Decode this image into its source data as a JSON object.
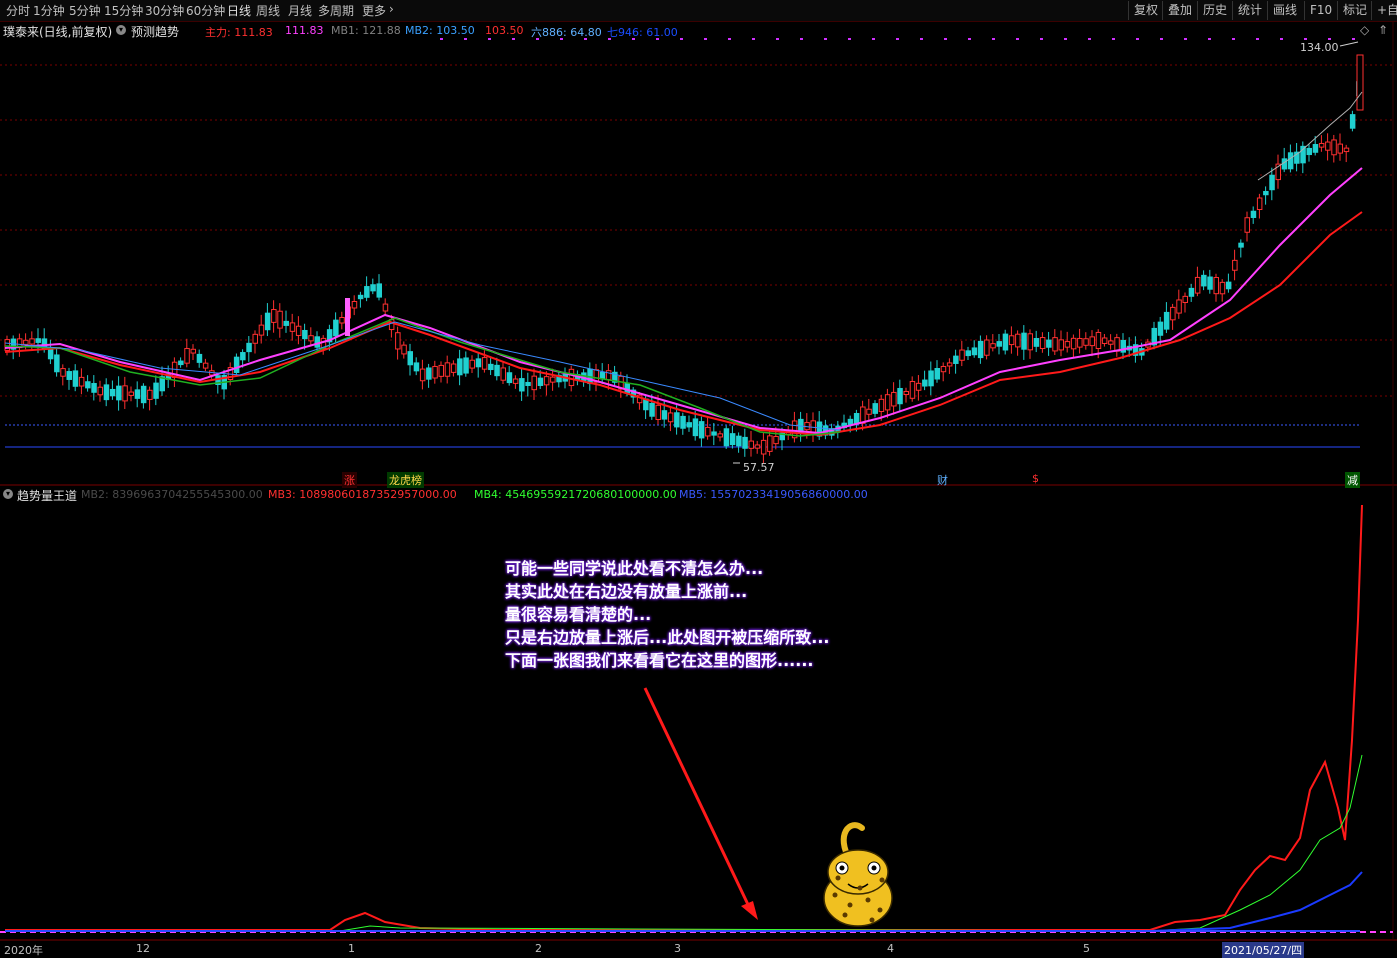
{
  "toolbar": {
    "periods": [
      "分时",
      "1分钟",
      "5分钟",
      "15分钟",
      "30分钟",
      "60分钟",
      "日线",
      "周线",
      "月线",
      "多周期",
      "更多"
    ],
    "active_period": "日线",
    "more_arrow": "›",
    "right_buttons": [
      "复权",
      "叠加",
      "历史",
      "统计",
      "画线",
      "F10",
      "标记",
      "+自选"
    ]
  },
  "header": {
    "stock_title": "璞泰来(日线,前复权)",
    "forecast_label": "预测趋势",
    "indicators": [
      {
        "label": "主力: 111.83",
        "color": "#ff3030"
      },
      {
        "label": "111.83",
        "color": "#ff40ff"
      },
      {
        "label": "MB1: 121.88",
        "color": "#808080"
      },
      {
        "label": "MB2: 103.50",
        "color": "#3aa0ff"
      },
      {
        "label": "103.50",
        "color": "#ff3030"
      },
      {
        "label": "六886: 64.80",
        "color": "#5fb0ff"
      },
      {
        "label": "七946: 61.00",
        "color": "#1a4dff"
      }
    ]
  },
  "price_chart": {
    "high_marker": "134.00",
    "low_marker": "57.57",
    "events": [
      {
        "label": "涨",
        "color": "#ff3030",
        "bg": "#2a0000"
      },
      {
        "label": "龙虎榜",
        "color": "#ffd84a",
        "bg": "#003a00"
      },
      {
        "label": "财",
        "color": "#5fb0ff",
        "bg": "#000"
      },
      {
        "label": "$",
        "color": "#ff3030",
        "bg": "#000"
      },
      {
        "label": "减",
        "color": "#ffffff",
        "bg": "#005500"
      }
    ]
  },
  "indicator_panel": {
    "name": "趋势量王道",
    "lines": [
      {
        "label": "MB2: 8396963704255545300.00",
        "color": "#4a4a4a"
      },
      {
        "label": "MB3: 10898060187352957000.00",
        "color": "#ff3030"
      },
      {
        "label": "MB4: 4546955921720680100000.00",
        "color": "#30ff30"
      },
      {
        "label": "MB5: 15570233419056860000.00",
        "color": "#3a5aff"
      }
    ]
  },
  "annotation": {
    "lines": [
      "可能一些同学说此处看不清怎么办...",
      "其实此处在右边没有放量上涨前...",
      "量很容易看清楚的...",
      "只是右边放量上涨后...此处图开被压缩所致...",
      "下面一张图我们来看看它在这里的图形......"
    ]
  },
  "x_axis": {
    "labels": [
      "2020年",
      "12",
      "1",
      "2",
      "3",
      "4",
      "5"
    ],
    "cursor_date": "2021/05/27/四"
  },
  "colors": {
    "up": "#ff3030",
    "down": "#20d0d0",
    "ma_pink": "#ff40ff",
    "ma_red": "#ff1a1a",
    "ma_green": "#20b020",
    "ma_blue": "#3a8aff",
    "grid": "#7a0000"
  },
  "icons": [
    "dropdown-circle-icon",
    "up-arrow-icon",
    "leopard-mascot-icon",
    "diamond-icon"
  ]
}
